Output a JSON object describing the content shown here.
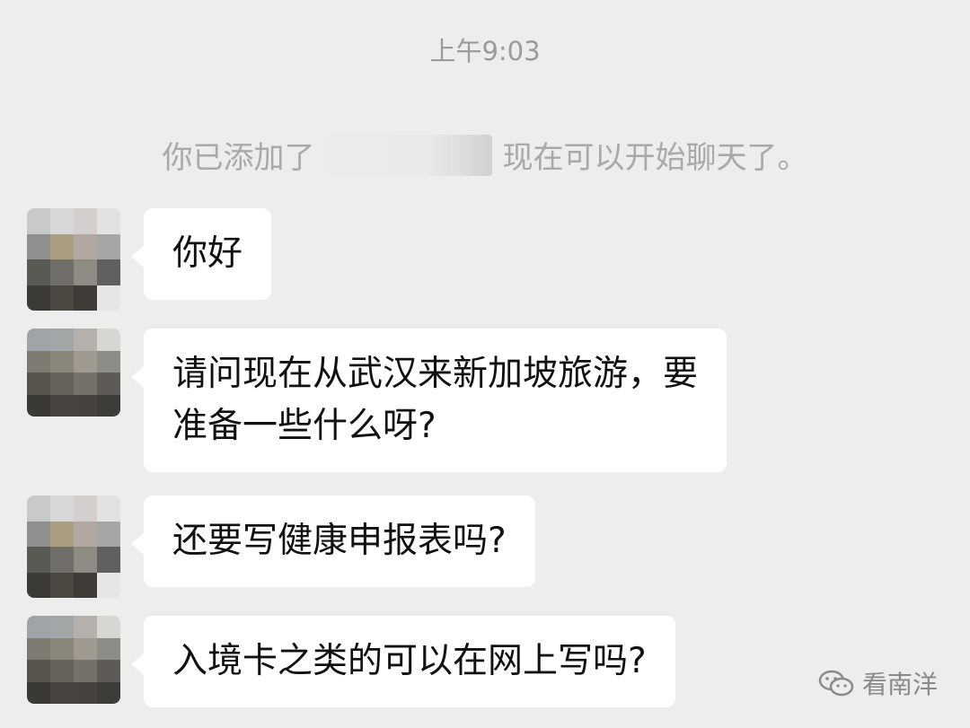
{
  "chat": {
    "timestamp": "上午9:03",
    "notice_prefix": "你已添加了",
    "notice_suffix": "现在可以开始聊天了。",
    "messages": [
      {
        "text": "你好"
      },
      {
        "text": "请问现在从武汉来新加坡旅游，要\n准备一些什么呀?"
      },
      {
        "text": "还要写健康申报表吗?"
      },
      {
        "text": "入境卡之类的可以在网上写吗?"
      }
    ]
  },
  "watermark": {
    "label": "看南洋",
    "icon": "wechat-channel-icon"
  },
  "colors": {
    "background": "#ededed",
    "bubble": "#ffffff",
    "timestamp_text": "#9b9b9b",
    "message_text": "#111111"
  }
}
